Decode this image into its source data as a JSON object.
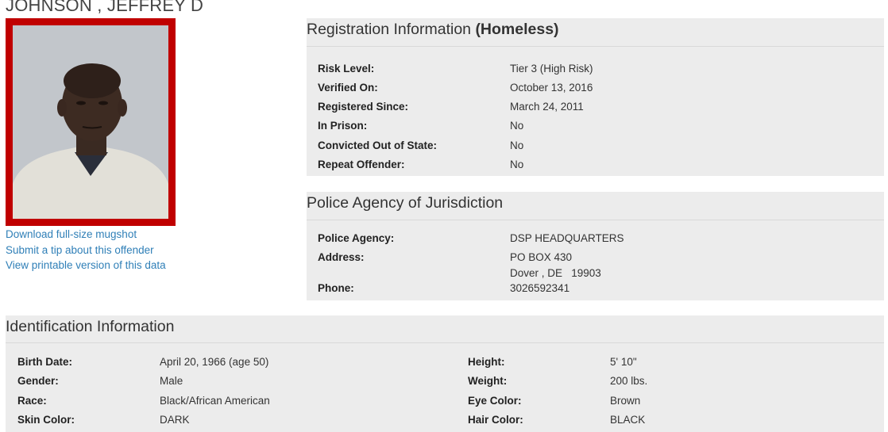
{
  "offender": {
    "name": "JOHNSON , JEFFREY D"
  },
  "links": [
    {
      "label": "Download full-size mugshot"
    },
    {
      "label": "Submit a tip about this offender"
    },
    {
      "label": "View printable version of this data"
    }
  ],
  "registration": {
    "title": "Registration Information ",
    "title_bold": "(Homeless)",
    "rows": [
      {
        "label": "Risk Level:",
        "value": "Tier 3 (High Risk)"
      },
      {
        "label": "Verified On:",
        "value": "October 13, 2016"
      },
      {
        "label": "Registered Since:",
        "value": "March 24, 2011"
      },
      {
        "label": "In Prison:",
        "value": "No"
      },
      {
        "label": "Convicted Out of State:",
        "value": "No"
      },
      {
        "label": "Repeat Offender:",
        "value": "No"
      }
    ]
  },
  "police": {
    "title": "Police Agency of Jurisdiction",
    "agency_label": "Police Agency:",
    "agency_value": "DSP HEADQUARTERS",
    "address_label": "Address:",
    "address_line1": "PO BOX 430",
    "address_line2": "Dover , DE   19903",
    "phone_label": "Phone:",
    "phone_value": "3026592341"
  },
  "identification": {
    "title": "Identification Information",
    "left": [
      {
        "label": "Birth Date:",
        "value": "April 20, 1966 (age 50)"
      },
      {
        "label": "Gender:",
        "value": "Male"
      },
      {
        "label": "Race:",
        "value": "Black/African American"
      },
      {
        "label": "Skin Color:",
        "value": "DARK"
      }
    ],
    "right": [
      {
        "label": "Height:",
        "value": "5' 10\""
      },
      {
        "label": "Weight:",
        "value": "200 lbs."
      },
      {
        "label": "Eye Color:",
        "value": "Brown"
      },
      {
        "label": "Hair Color:",
        "value": "BLACK"
      }
    ]
  },
  "colors": {
    "frame": "#c00000",
    "link": "#2f7fb7",
    "panel_bg": "#ececec"
  }
}
